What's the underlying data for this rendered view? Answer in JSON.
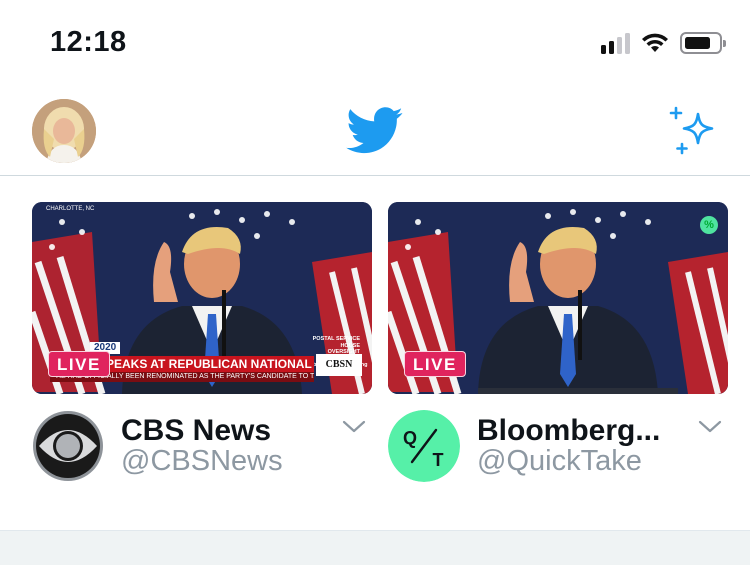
{
  "status_bar": {
    "time": "12:18",
    "icons": [
      "cellular-signal-icon",
      "wifi-icon",
      "battery-icon"
    ]
  },
  "header": {
    "avatar": "profile-avatar",
    "logo": "twitter-bird-icon",
    "action": "sparkle-icon"
  },
  "fleets": [
    {
      "live_label": "LIVE",
      "broadcast": {
        "dateline": "CHARLOTTE, NC",
        "year_tag": "2020",
        "headline": "SPEAKS AT REPUBLICAN NATIONAL CONVENTION",
        "subline": "HE HAS OFFICIALLY BEEN RENOMINATED AS THE PARTY'S CANDIDATE TO TAKE ON JOE BIDEN FOR THE PRESIDENCY",
        "network_bug": "CBSN",
        "side_caption": "POSTAL SERVICE HOUSE OVERSIGHT HEARING cbsnews.com/hearing"
      },
      "channel": {
        "name": "CBS News",
        "handle": "@CBSNews"
      }
    },
    {
      "live_label": "LIVE",
      "badge": "%",
      "channel": {
        "name": "Bloomberg...",
        "handle": "@QuickTake"
      }
    }
  ],
  "colors": {
    "twitter_blue": "#1d9bf0",
    "live_red": "#e0245e",
    "handle_gray": "#8d98a2",
    "quicktake_green": "#4fe3a0"
  }
}
